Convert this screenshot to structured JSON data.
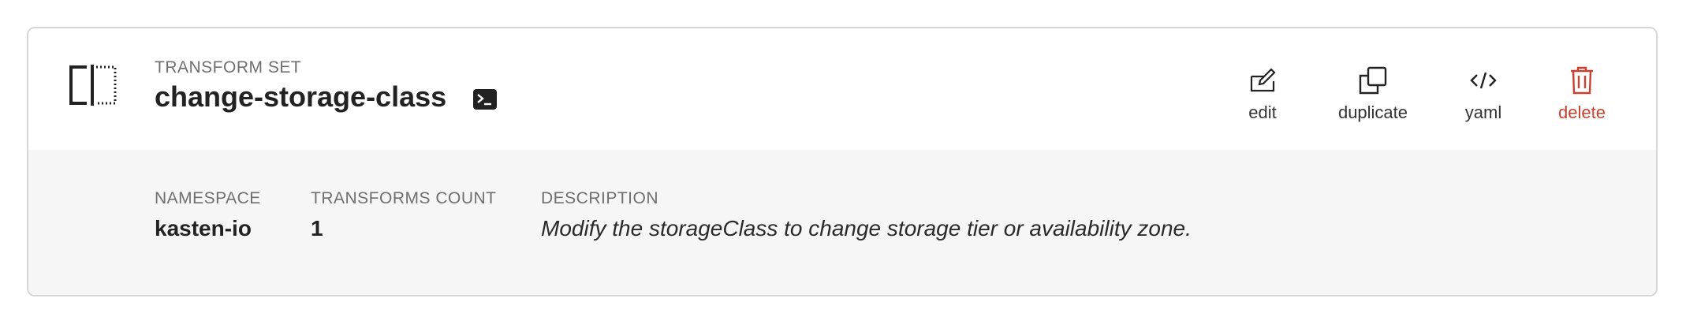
{
  "card": {
    "kind": "TRANSFORM SET",
    "name": "change-storage-class"
  },
  "actions": {
    "edit": "edit",
    "duplicate": "duplicate",
    "yaml": "yaml",
    "delete": "delete"
  },
  "fields": {
    "namespace_label": "NAMESPACE",
    "namespace_value": "kasten-io",
    "count_label": "TRANSFORMS COUNT",
    "count_value": "1",
    "description_label": "DESCRIPTION",
    "description_value": "Modify the storageClass to change storage tier or availability zone."
  },
  "icons": {
    "type": "transform-set-icon",
    "terminal": "terminal-icon",
    "edit": "edit-icon",
    "duplicate": "duplicate-icon",
    "yaml": "code-icon",
    "delete": "trash-icon"
  },
  "colors": {
    "danger": "#c8412f",
    "body_bg": "#f6f6f6",
    "border": "#d6d6d6"
  }
}
